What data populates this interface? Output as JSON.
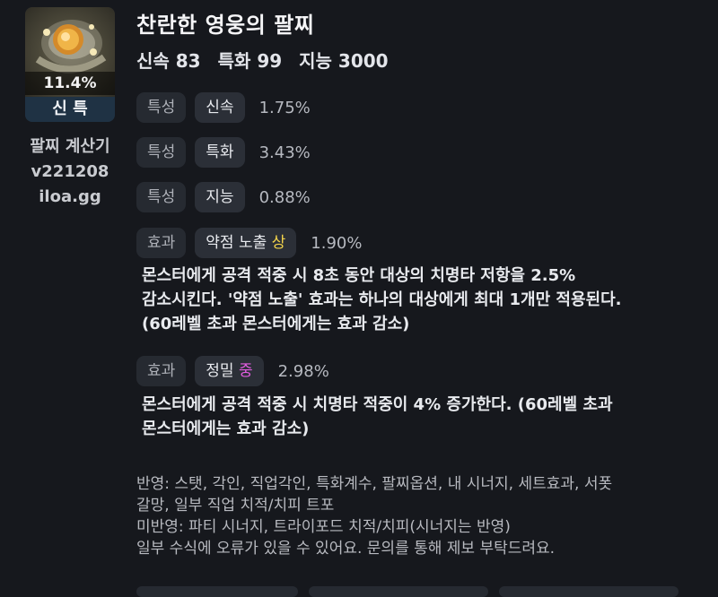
{
  "item": {
    "quality": "11.4%",
    "stat_combo": "신 특",
    "calculator": {
      "name": "팔찌 계산기",
      "version": "v221208",
      "site": "iloa.gg"
    },
    "title": "찬란한 영웅의 팔찌",
    "stats": {
      "speed": "신속 83",
      "specialty": "특화 99",
      "intellect": "지능 3000"
    }
  },
  "traits": [
    {
      "kind": "특성",
      "name": "신속",
      "pct": "1.75%"
    },
    {
      "kind": "특성",
      "name": "특화",
      "pct": "3.43%"
    },
    {
      "kind": "특성",
      "name": "지능",
      "pct": "0.88%"
    }
  ],
  "effects": [
    {
      "kind": "효과",
      "name": "약점 노출",
      "grade": "상",
      "pct": "1.90%",
      "desc_lines": [
        "몬스터에게 공격 적중 시 8초 동안 대상의 치명타 저항을 2.5%",
        "감소시킨다. '약점 노출' 효과는 하나의 대상에게 최대 1개만 적용된다.",
        "(60레벨 초과 몬스터에게는 효과 감소)"
      ]
    },
    {
      "kind": "효과",
      "name": "정밀",
      "grade": "중",
      "pct": "2.98%",
      "desc_lines": [
        "몬스터에게 공격 적중 시 치명타 적중이 4% 증가한다. (60레벨 초과",
        "몬스터에게는 효과 감소)"
      ]
    }
  ],
  "notes": [
    "반영: 스탯, 각인, 직업각인, 특화계수, 팔찌옵션, 내 시너지, 세트효과, 서폿",
    "갈망, 일부 직업 치적/치피 트포",
    "미반영: 파티 시너지, 트라이포드 치적/치피(시너지는 반영)",
    "일부 수식에 오류가 있을 수 있어요. 문의를 통해 제보 부탁드려요."
  ],
  "colors": {
    "background": "#16181d",
    "chip": "#262a31",
    "grade_high": "#f2d34b",
    "grade_mid": "#e15ddf",
    "stat_combo_bg": "#1f3244"
  }
}
